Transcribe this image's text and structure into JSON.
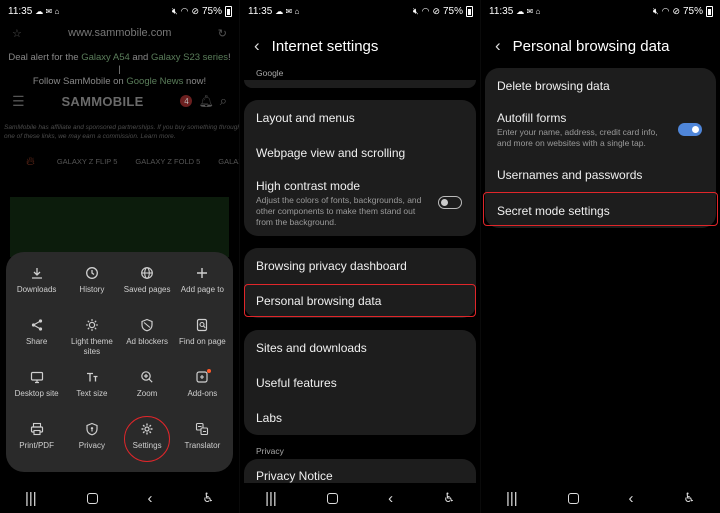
{
  "status": {
    "time": "11:35",
    "battery": "75%"
  },
  "browser": {
    "url": "www.sammobile.com",
    "deal_line1_pre": "Deal alert for the ",
    "deal_link1": "Galaxy A54",
    "deal_line1_mid": " and ",
    "deal_link2": "Galaxy S23 series",
    "deal_line1_post": "! |",
    "deal_line2_pre": "Follow SamMobile on ",
    "deal_link3": "Google News",
    "deal_line2_post": " now!",
    "logo": "SAMMOBILE",
    "notif_count": "4",
    "affiliate_line1": "SamMobile has affiliate and sponsored partnerships. If you buy something through",
    "affiliate_line2": "one of these links, we may earn a commission. Learn more.",
    "categories": [
      "GALAXY Z FLIP 5",
      "GALAXY Z FOLD 5",
      "GALAXY S"
    ],
    "menu": [
      {
        "label": "Downloads",
        "icon": "download-icon"
      },
      {
        "label": "History",
        "icon": "clock-icon"
      },
      {
        "label": "Saved pages",
        "icon": "globe-icon"
      },
      {
        "label": "Add page to",
        "icon": "plus-icon"
      },
      {
        "label": "Share",
        "icon": "share-icon"
      },
      {
        "label": "Light theme sites",
        "icon": "sun-icon"
      },
      {
        "label": "Ad blockers",
        "icon": "shield-block-icon"
      },
      {
        "label": "Find on page",
        "icon": "find-icon"
      },
      {
        "label": "Desktop site",
        "icon": "desktop-icon"
      },
      {
        "label": "Text size",
        "icon": "text-size-icon"
      },
      {
        "label": "Zoom",
        "icon": "zoom-icon"
      },
      {
        "label": "Add-ons",
        "icon": "addons-icon"
      },
      {
        "label": "Print/PDF",
        "icon": "print-icon"
      },
      {
        "label": "Privacy",
        "icon": "privacy-shield-icon"
      },
      {
        "label": "Settings",
        "icon": "gear-icon"
      },
      {
        "label": "Translator",
        "icon": "translate-icon"
      }
    ]
  },
  "internet_settings": {
    "title": "Internet settings",
    "section_google": "Google",
    "layout_menus": "Layout and menus",
    "webpage_view": "Webpage view and scrolling",
    "high_contrast": "High contrast mode",
    "high_contrast_desc": "Adjust the colors of fonts, backgrounds, and other components to make them stand out from the background.",
    "privacy_dashboard": "Browsing privacy dashboard",
    "personal_data": "Personal browsing data",
    "sites_downloads": "Sites and downloads",
    "useful_features": "Useful features",
    "labs": "Labs",
    "section_privacy": "Privacy",
    "privacy_notice": "Privacy Notice"
  },
  "personal_browsing": {
    "title": "Personal browsing data",
    "delete": "Delete browsing data",
    "autofill": "Autofill forms",
    "autofill_desc": "Enter your name, address, credit card info, and more on websites with a single tap.",
    "usernames": "Usernames and passwords",
    "secret_mode": "Secret mode settings"
  },
  "colors": {
    "accent_blue": "#4f86d9",
    "highlight_red": "#e0262a"
  }
}
